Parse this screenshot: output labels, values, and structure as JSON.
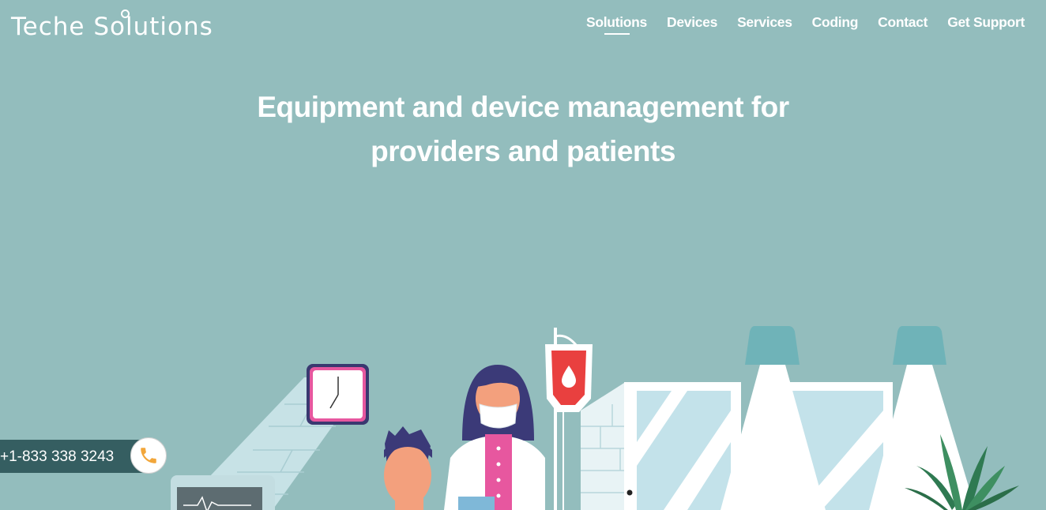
{
  "header": {
    "logo_text": "Teche Solutions",
    "nav": [
      {
        "label": "Solutions",
        "active": true
      },
      {
        "label": "Devices"
      },
      {
        "label": "Services"
      },
      {
        "label": "Coding"
      },
      {
        "label": "Contact"
      },
      {
        "label": "Get Support"
      }
    ]
  },
  "hero": {
    "title_line1": "Equipment and device management for",
    "title_line2": "providers and patients"
  },
  "phone_widget": {
    "number": "+1-833 338 3243",
    "icon": "phone-icon"
  },
  "colors": {
    "background": "#93bdbd",
    "phone_bar": "#355e61",
    "phone_icon": "#f2a63a",
    "lamp": "#6fb3b8",
    "blood_bag": "#e9403f"
  }
}
